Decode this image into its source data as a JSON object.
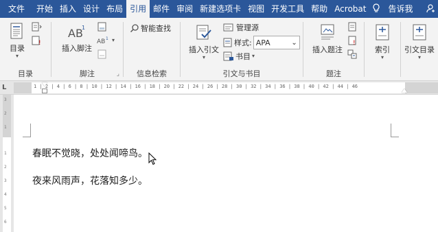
{
  "tabs": [
    {
      "label": "文件",
      "active": false
    },
    {
      "label": "开始",
      "active": false
    },
    {
      "label": "插入",
      "active": false
    },
    {
      "label": "设计",
      "active": false
    },
    {
      "label": "布局",
      "active": false
    },
    {
      "label": "引用",
      "active": true
    },
    {
      "label": "邮件",
      "active": false
    },
    {
      "label": "审阅",
      "active": false
    },
    {
      "label": "新建选项卡",
      "active": false
    },
    {
      "label": "视图",
      "active": false
    },
    {
      "label": "开发工具",
      "active": false
    },
    {
      "label": "帮助",
      "active": false
    },
    {
      "label": "Acrobat",
      "active": false
    }
  ],
  "tell_me": "告诉我",
  "ribbon": {
    "toc": {
      "button": "目录",
      "group": "目录"
    },
    "footnote": {
      "insert": "插入脚注",
      "group": "脚注"
    },
    "research": {
      "smart_lookup": "智能查找",
      "group": "信息检索"
    },
    "citations": {
      "insert": "插入引文",
      "manage": "管理源",
      "style_label": "样式:",
      "style_value": "APA",
      "bibliography": "书目",
      "group": "引文与书目"
    },
    "captions": {
      "insert": "插入题注",
      "group": "题注"
    },
    "index": {
      "button": "索引"
    },
    "toa": {
      "button": "引文目录"
    }
  },
  "ruler_labels": "1 | 2 | 4 | 6 | 8 | 10 | 12 | 14 | 16 | 18 | 20 | 22 | 24 | 26 | 28 | 30 | 32 | 34 | 36 | 38 | 40 | 42 | 44 | 46",
  "vruler_labels": [
    "3",
    "2",
    "1",
    "1",
    "2",
    "3",
    "4",
    "5",
    "6"
  ],
  "document": {
    "lines": [
      "春眠不觉晓，处处闻啼鸟。",
      "夜来风雨声，花落知多少。"
    ]
  },
  "colors": {
    "accent": "#2b579a",
    "ribbon": "#f3f3f3"
  }
}
